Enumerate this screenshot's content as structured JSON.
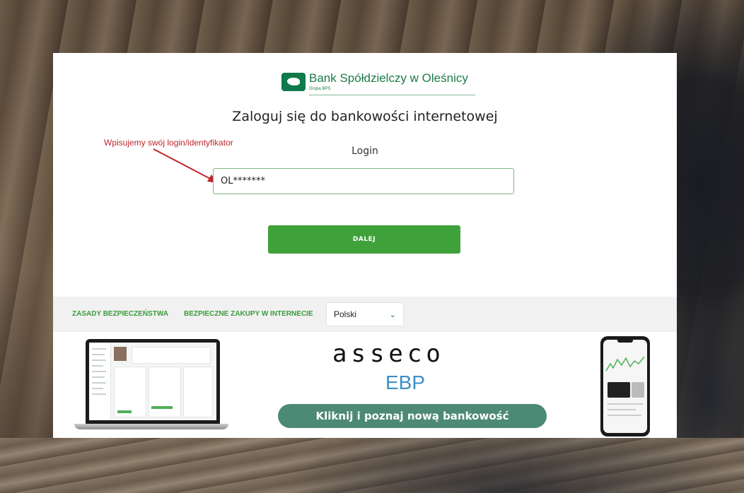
{
  "bank": {
    "name": "Bank Spółdzielczy w Oleśnicy",
    "group": "Grupa BPS"
  },
  "login": {
    "title": "Zaloguj się do bankowości internetowej",
    "field_label": "Login",
    "field_value": "OL*******",
    "submit_label": "DALEJ"
  },
  "annotation": {
    "text": "Wpisujemy swój login/identyfikator",
    "color": "#c0262b"
  },
  "footer": {
    "links": [
      {
        "label": "ZASADY BEZPIECZEŃSTWA"
      },
      {
        "label": "BEZPIECZNE ZAKUPY W INTERNECIE"
      }
    ],
    "language": {
      "selected": "Polski"
    }
  },
  "promo": {
    "brand": "asseco",
    "product": "EBP",
    "cta_label": "Kliknij i poznaj nową bankowość"
  },
  "colors": {
    "accent": "#3fa13a",
    "brand_green": "#1d7a48",
    "cta": "#4d8a75",
    "ebp_blue": "#3d8fc6"
  }
}
